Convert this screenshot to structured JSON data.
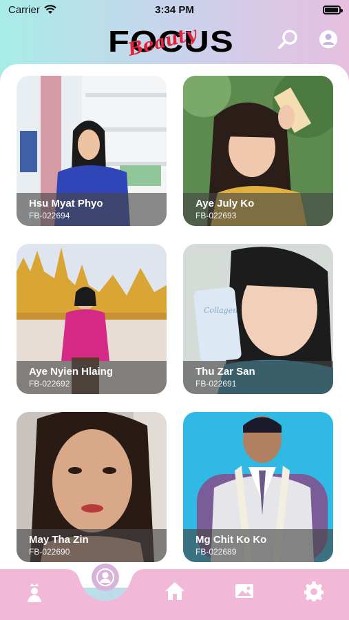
{
  "status_bar": {
    "carrier": "Carrier",
    "time": "3:34 PM"
  },
  "header": {
    "logo_main": "FOCUS",
    "logo_script": "Beauty",
    "search_icon": "search-icon",
    "profile_icon": "user-icon"
  },
  "contestants": [
    {
      "name": "Hsu Myat Phyo",
      "code": "FB-022694"
    },
    {
      "name": "Aye July Ko",
      "code": "FB-022693"
    },
    {
      "name": "Aye Nyien Hlaing",
      "code": "FB-022692"
    },
    {
      "name": "Thu Zar San",
      "code": "FB-022691"
    },
    {
      "name": "May Tha Zin",
      "code": "FB-022690"
    },
    {
      "name": "Mg Chit Ko Ko",
      "code": "FB-022689"
    }
  ],
  "bottom_nav": {
    "items": [
      "crown-person-icon",
      "contestant-icon",
      "home-icon",
      "gallery-icon",
      "settings-icon"
    ],
    "active": "contestant-icon"
  },
  "colors": {
    "accent_pink": "#e6aed3",
    "logo_red": "#e0243a",
    "nav_bg": "#f2b8d8"
  }
}
